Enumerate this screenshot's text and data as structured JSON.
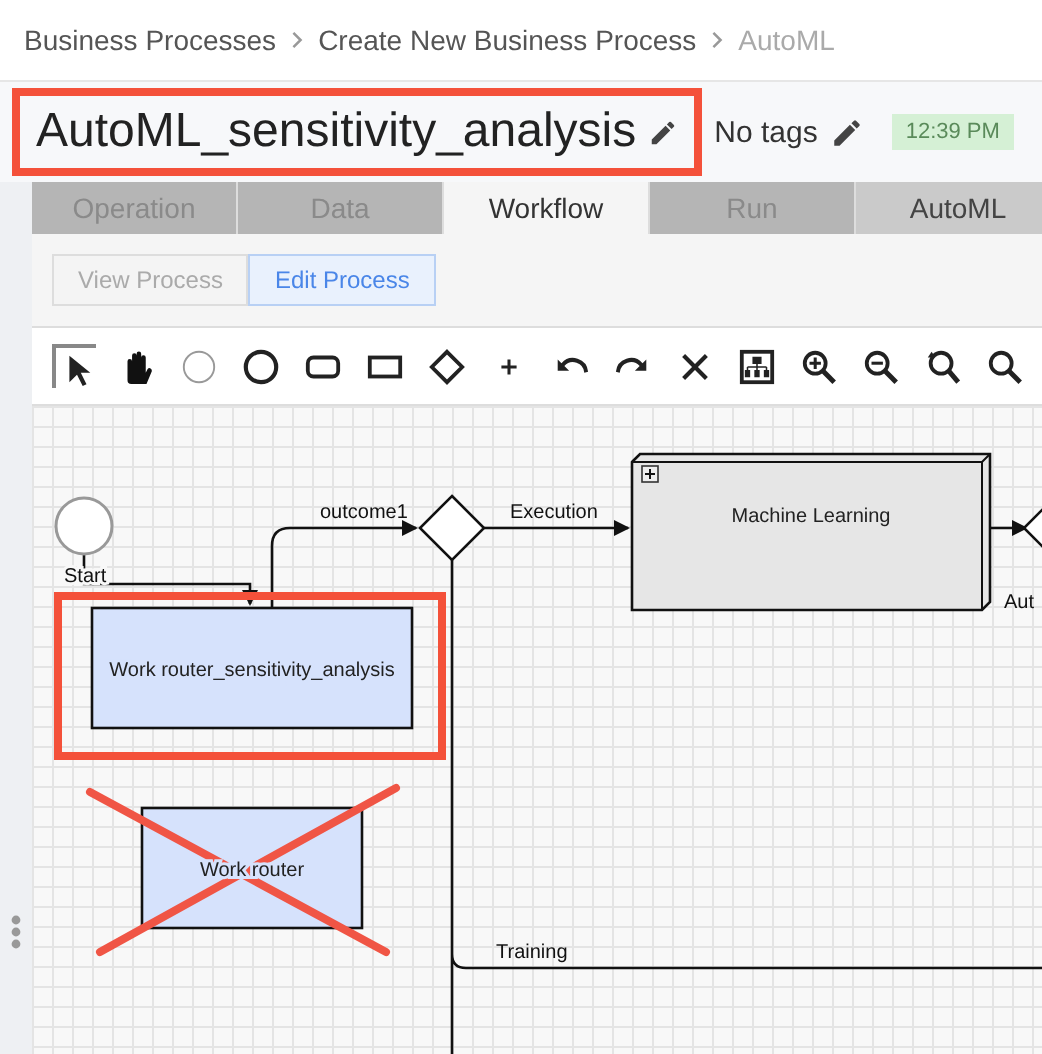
{
  "breadcrumb": [
    {
      "label": "Business Processes",
      "current": false
    },
    {
      "label": "Create New Business Process",
      "current": false
    },
    {
      "label": "AutoML",
      "current": true
    }
  ],
  "title": {
    "text": "AutoML_sensitivity_analysis",
    "highlighted": true
  },
  "tags": {
    "text": "No tags"
  },
  "time_badge": "12:39 PM",
  "tabs": [
    {
      "label": "Operation",
      "selected": false,
      "disabled": true
    },
    {
      "label": "Data",
      "selected": false,
      "disabled": true
    },
    {
      "label": "Workflow",
      "selected": true,
      "disabled": false
    },
    {
      "label": "Run",
      "selected": false,
      "disabled": true
    },
    {
      "label": "AutoML",
      "selected": false,
      "disabled": false
    }
  ],
  "modes": [
    {
      "label": "View Process",
      "selected": false
    },
    {
      "label": "Edit Process",
      "selected": true
    }
  ],
  "toolbar": [
    {
      "kind": "pointer",
      "selected": true
    },
    {
      "kind": "hand",
      "selected": false
    },
    {
      "kind": "thin-circle",
      "selected": false
    },
    {
      "kind": "thick-circle",
      "selected": false
    },
    {
      "kind": "rounded-rect",
      "selected": false
    },
    {
      "kind": "rect",
      "selected": false
    },
    {
      "kind": "diamond",
      "selected": false
    },
    {
      "kind": "plus",
      "selected": false
    },
    {
      "kind": "undo",
      "selected": false
    },
    {
      "kind": "redo",
      "selected": false
    },
    {
      "kind": "delete",
      "selected": false
    },
    {
      "kind": "layout",
      "selected": false
    },
    {
      "kind": "zoom-in",
      "selected": false
    },
    {
      "kind": "zoom-out",
      "selected": false
    },
    {
      "kind": "zoom-reset",
      "selected": false
    },
    {
      "kind": "zoom",
      "selected": false
    }
  ],
  "diagram": {
    "nodes": [
      {
        "kind": "start",
        "label": "Start"
      },
      {
        "kind": "task",
        "label": "Work router_sensitivity_analysis",
        "highlighted": true
      },
      {
        "kind": "gateway"
      },
      {
        "kind": "subprocess",
        "label": "Machine Learning"
      },
      {
        "kind": "gateway",
        "label": "Aut"
      },
      {
        "kind": "task",
        "label": "Work router",
        "crossed": true
      }
    ],
    "edges": [
      {
        "label": "outcome1"
      },
      {
        "label": "Execution"
      },
      {
        "label": "Training"
      }
    ]
  }
}
